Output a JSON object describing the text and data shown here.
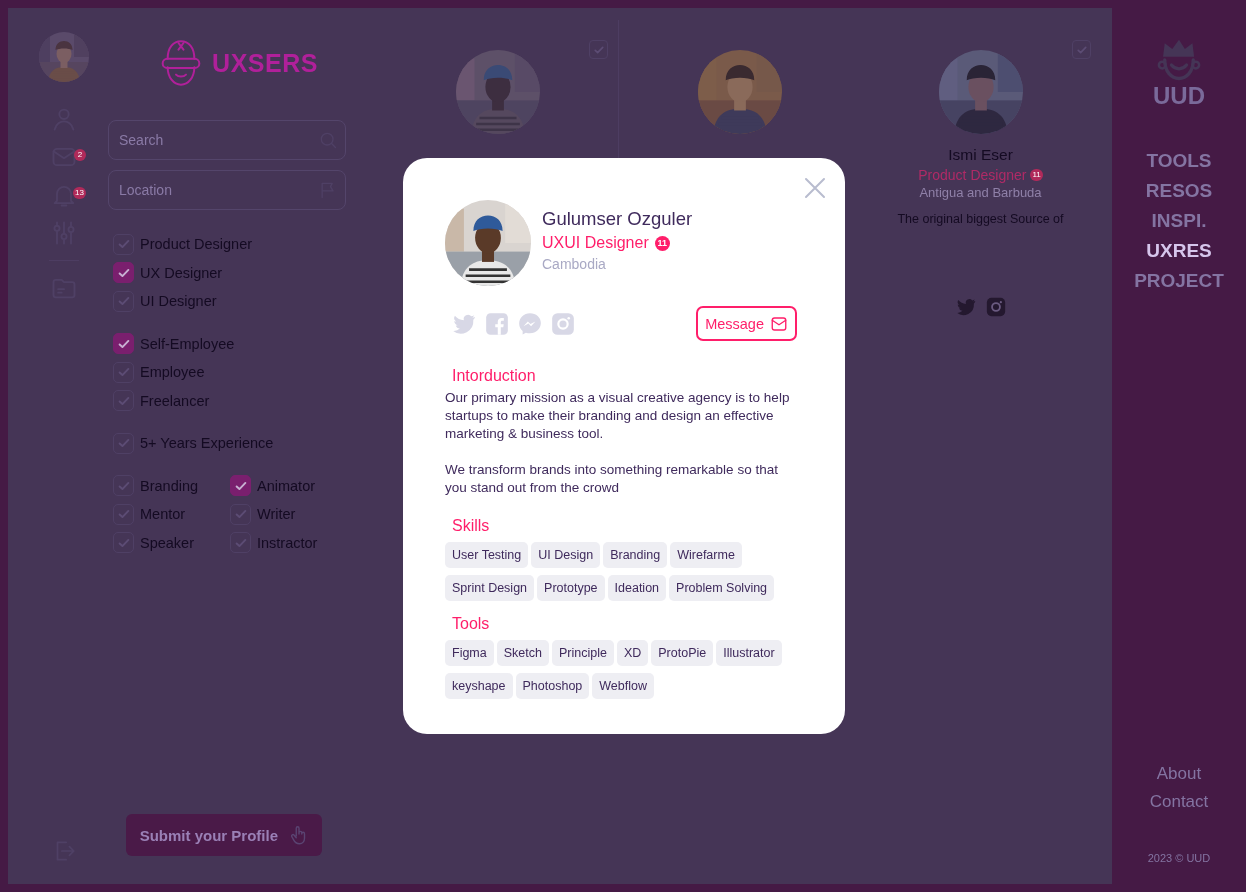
{
  "nav_rail": {
    "items": [
      {
        "kind": "profile"
      },
      {
        "kind": "mail",
        "badge": "2"
      },
      {
        "kind": "bell",
        "badge": "13"
      },
      {
        "kind": "sliders"
      },
      {
        "kind": "folder"
      }
    ]
  },
  "logo": {
    "text": "UXSERS"
  },
  "filters": {
    "search": {
      "placeholder": "Search"
    },
    "location": {
      "placeholder": "Location"
    },
    "groups": [
      {
        "kind": "list",
        "items": [
          {
            "label": "Product Designer",
            "checked": false
          },
          {
            "label": "UX Designer",
            "checked": true
          },
          {
            "label": "UI Designer",
            "checked": false
          }
        ]
      },
      {
        "kind": "list",
        "items": [
          {
            "label": "Self-Employee",
            "checked": true
          },
          {
            "label": "Employee",
            "checked": false
          },
          {
            "label": "Freelancer",
            "checked": false
          }
        ]
      },
      {
        "kind": "list",
        "items": [
          {
            "label": "5+ Years Experience",
            "checked": false
          }
        ]
      },
      {
        "kind": "grid",
        "items": [
          {
            "label": "Branding",
            "checked": false
          },
          {
            "label": "Animator",
            "checked": true
          },
          {
            "label": "Mentor",
            "checked": false
          },
          {
            "label": "Writer",
            "checked": false
          },
          {
            "label": "Speaker",
            "checked": false
          },
          {
            "label": "Instractor",
            "checked": false
          }
        ]
      }
    ]
  },
  "submit_button": {
    "label": "Submit your Profile"
  },
  "cards": [
    {
      "kind": "profile",
      "checked": false
    },
    {
      "kind": "profile"
    },
    {
      "kind": "profile",
      "name": "Ismi Eser",
      "role": "Product Designer",
      "badge": "11",
      "location": "Antigua and Barbuda",
      "description": "The original biggest Source of",
      "socials": [
        {
          "kind": "twitter"
        },
        {
          "kind": "instagram"
        }
      ],
      "checked": false
    }
  ],
  "side_menu": {
    "brand": "UUD",
    "items": [
      {
        "label": "TOOLS",
        "selected": false
      },
      {
        "label": "RESOS",
        "selected": false
      },
      {
        "label": "INSPI.",
        "selected": false
      },
      {
        "label": "UXRES",
        "selected": true
      },
      {
        "label": "PROJECT",
        "selected": false
      }
    ],
    "footer_links": [
      "About",
      "Contact"
    ],
    "copyright": "2023 © UUD"
  },
  "modal": {
    "name": "Gulumser Ozguler",
    "role": "UXUI Designer",
    "badge": "11",
    "location": "Cambodia",
    "socials": [
      {
        "kind": "twitter"
      },
      {
        "kind": "facebook"
      },
      {
        "kind": "messenger"
      },
      {
        "kind": "instagram"
      }
    ],
    "message_button": "Message",
    "sections": [
      {
        "kind": "text",
        "title": "Intorduction",
        "paragraphs": [
          "Our primary mission as a visual creative agency is to help startups to make their branding and design an effective marketing & business tool.",
          "We transform brands into something remarkable so that you stand out from the crowd"
        ]
      },
      {
        "kind": "tags",
        "title": "Skills",
        "rows": [
          [
            "User Testing",
            "UI Design",
            "Branding",
            "Wirefarme"
          ],
          [
            "Sprint Design",
            "Prototype",
            "Ideation",
            "Problem Solving"
          ]
        ]
      },
      {
        "kind": "tags",
        "title": "Tools",
        "rows": [
          [
            "Figma",
            "Sketch",
            "Principle",
            "XD",
            "ProtoPie",
            "Illustrator"
          ],
          [
            "keyshape",
            "Photoshop",
            "Webflow"
          ]
        ]
      }
    ]
  }
}
